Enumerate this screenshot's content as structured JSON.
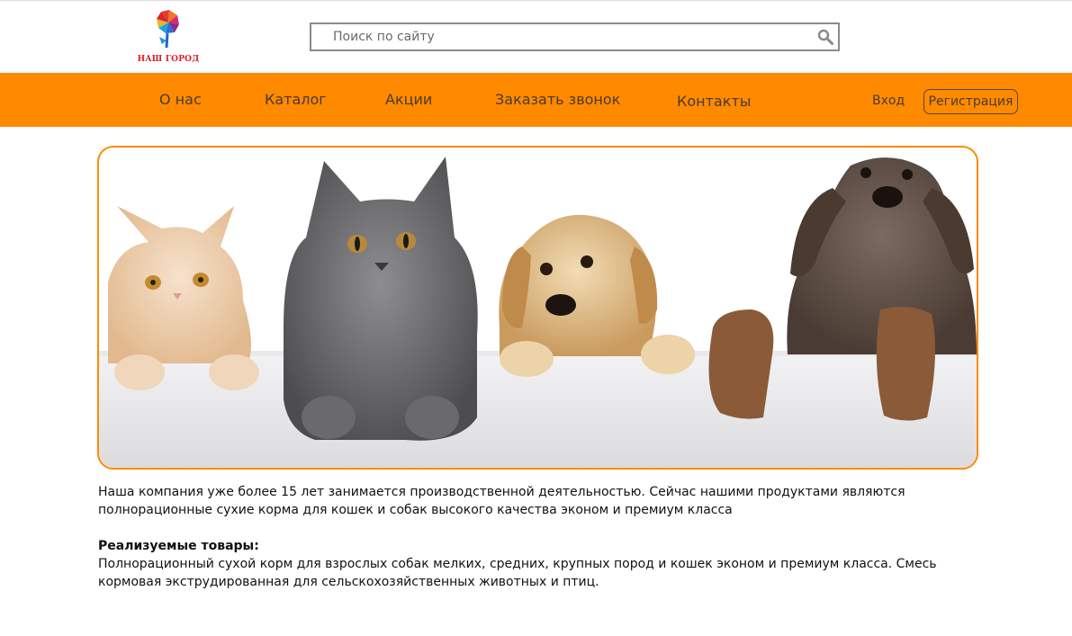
{
  "header": {
    "logo_text": "НАШ ГОРОД",
    "search_placeholder": "Поиск по сайту"
  },
  "nav": {
    "items": [
      "О нас",
      "Каталог",
      "Акции",
      "Заказать звонок",
      "Контакты"
    ],
    "login_label": "Вход",
    "register_label": "Регистрация"
  },
  "banner": {
    "animals": [
      "kitten-ginger",
      "kitten-grey",
      "puppy-golden",
      "puppy-brown"
    ]
  },
  "content": {
    "intro": "Наша компания уже более 15 лет занимается производственной деятельностью. Сейчас нашими продуктами являются полнорационные сухие корма для кошек и собак высокого качества эконом и премиум класса",
    "products_heading": "Реализуемые товары:",
    "products_text": "Полнорационный сухой корм для взрослых собак мелких, средних, крупных пород и кошек эконом и премиум класса. Смесь кормовая экструдированная для сельскохозяйственных животных и птиц."
  },
  "colors": {
    "accent": "#ff8a00",
    "logo_red": "#d81f26"
  }
}
